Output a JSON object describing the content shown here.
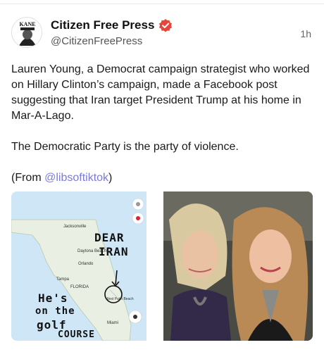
{
  "author": {
    "display_name": "Citizen Free Press",
    "handle": "@CitizenFreePress",
    "avatar_label": "KANE"
  },
  "post": {
    "time": "1h",
    "paragraph1": "Lauren Young, a Democrat campaign strategist who worked on Hillary Clinton’s campaign, made a Facebook post suggesting that Iran target President Trump at his home in Mar-A-Lago.",
    "paragraph2": "The Democratic Party is the party of violence.",
    "from_prefix": "(From ",
    "from_link": "@libsoftiktok",
    "from_suffix": ")"
  },
  "map_image": {
    "labels": {
      "jacksonville": "Jacksonville",
      "daytona": "Daytona Beach",
      "orlando": "Orlando",
      "tampa": "Tampa",
      "florida": "FLORIDA",
      "west_palm": "West Palm Beach",
      "miami": "Miami"
    },
    "handwriting": {
      "dear": "DEAR",
      "iran": "IRAN",
      "hes": "He's",
      "on_the": "on the",
      "golf": "golf",
      "course": "COURSE"
    }
  },
  "colors": {
    "verified": "#e8443a",
    "link": "#7a7adf",
    "water": "#cfe6f7",
    "land": "#e9efe2"
  }
}
